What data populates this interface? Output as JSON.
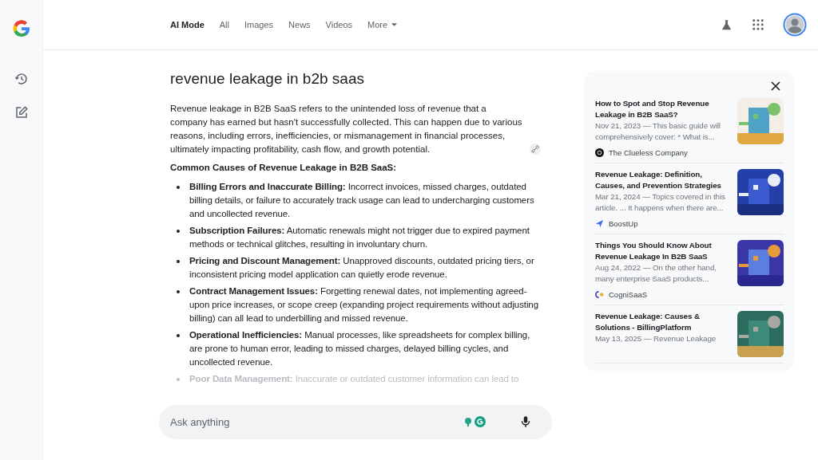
{
  "nav": {
    "tabs": [
      {
        "label": "AI Mode",
        "selected": true
      },
      {
        "label": "All",
        "selected": false
      },
      {
        "label": "Images",
        "selected": false
      },
      {
        "label": "News",
        "selected": false
      },
      {
        "label": "Videos",
        "selected": false
      },
      {
        "label": "More",
        "selected": false,
        "dropdown": true
      }
    ]
  },
  "answer": {
    "query": "revenue leakage in b2b saas",
    "intro": "Revenue leakage in B2B SaaS refers to the unintended loss of revenue that a company has earned but hasn't successfully collected. This can happen due to various reasons, including errors, inefficiencies, or mismanagement in financial processes, ultimately impacting profitability, cash flow, and growth potential.",
    "heading": "Common Causes of Revenue Leakage in B2B SaaS:",
    "causes": [
      {
        "term": "Billing Errors and Inaccurate Billing:",
        "text": "Incorrect invoices, missed charges, outdated billing details, or failure to accurately track usage can lead to undercharging customers and uncollected revenue.",
        "faded": false
      },
      {
        "term": "Subscription Failures:",
        "text": "Automatic renewals might not trigger due to expired payment methods or technical glitches, resulting in involuntary churn.",
        "faded": false
      },
      {
        "term": "Pricing and Discount Management:",
        "text": "Unapproved discounts, outdated pricing tiers, or inconsistent pricing model application can quietly erode revenue.",
        "faded": false
      },
      {
        "term": "Contract Management Issues:",
        "text": "Forgetting renewal dates, not implementing agreed-upon price increases, or scope creep (expanding project requirements without adjusting billing) can all lead to underbilling and missed revenue.",
        "faded": false
      },
      {
        "term": "Operational Inefficiencies:",
        "text": "Manual processes, like spreadsheets for complex billing, are prone to human error, leading to missed charges, delayed billing cycles, and uncollected revenue.",
        "faded": false
      },
      {
        "term": "Poor Data Management:",
        "text": "Inaccurate or outdated customer information can lead to",
        "faded": true
      }
    ]
  },
  "sources": [
    {
      "title": "How to Spot and Stop Revenue Leakage in B2B SaaS?",
      "snippet": "Nov 21, 2023 — This basic guide will comprehensively cover: * What is...",
      "site": "The Clueless Company"
    },
    {
      "title": "Revenue Leakage: Definition, Causes, and Prevention Strategies",
      "snippet": "Mar 21, 2024 — Topics covered in this article. ... It happens when there are...",
      "site": "BoostUp"
    },
    {
      "title": "Things You Should Know About Revenue Leakage In B2B SaaS",
      "snippet": "Aug 24, 2022 — On the other hand, many enterprise SaaS products...",
      "site": "CogniSaaS"
    },
    {
      "title": "Revenue Leakage: Causes & Solutions - BillingPlatform",
      "snippet": "May 13, 2025 — Revenue Leakage"
    }
  ],
  "ask": {
    "placeholder": "Ask anything"
  }
}
